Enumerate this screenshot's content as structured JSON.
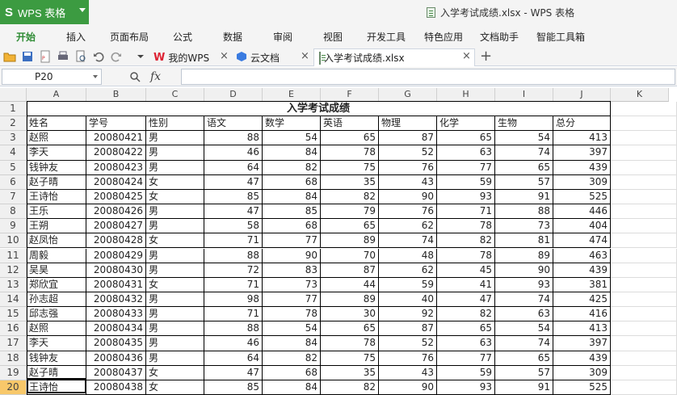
{
  "app": {
    "button_label": "WPS 表格",
    "window_title": "入学考试成绩.xlsx - WPS 表格"
  },
  "menu": [
    "开始",
    "插入",
    "页面布局",
    "公式",
    "数据",
    "审阅",
    "视图",
    "开发工具",
    "特色应用",
    "文档助手",
    "智能工具箱"
  ],
  "tabs": [
    {
      "label": "我的WPS",
      "icon": "wps-logo-icon"
    },
    {
      "label": "云文档",
      "icon": "cloud-cube-icon"
    },
    {
      "label": "入学考试成绩.xlsx",
      "icon": "spreadsheet-file-icon"
    }
  ],
  "formula_bar": {
    "name_box": "P20",
    "fx_label": "fx",
    "value": ""
  },
  "columns": [
    "A",
    "B",
    "C",
    "D",
    "E",
    "F",
    "G",
    "H",
    "I",
    "J",
    "K"
  ],
  "rows": [
    "1",
    "2",
    "3",
    "4",
    "5",
    "6",
    "7",
    "8",
    "9",
    "10",
    "11",
    "12",
    "13",
    "14",
    "15",
    "16",
    "17",
    "18",
    "19",
    "20"
  ],
  "selected_row": "20",
  "sheet": {
    "title": "入学考试成绩",
    "headers": [
      "姓名",
      "学号",
      "性别",
      "语文",
      "数学",
      "英语",
      "物理",
      "化学",
      "生物",
      "总分"
    ],
    "records": [
      [
        "赵照",
        "20080421",
        "男",
        "88",
        "54",
        "65",
        "87",
        "65",
        "54",
        "413"
      ],
      [
        "李天",
        "20080422",
        "男",
        "46",
        "84",
        "78",
        "52",
        "63",
        "74",
        "397"
      ],
      [
        "钱钟友",
        "20080423",
        "男",
        "64",
        "82",
        "75",
        "76",
        "77",
        "65",
        "439"
      ],
      [
        "赵子晴",
        "20080424",
        "女",
        "47",
        "68",
        "35",
        "43",
        "59",
        "57",
        "309"
      ],
      [
        "王诗怡",
        "20080425",
        "女",
        "85",
        "84",
        "82",
        "90",
        "93",
        "91",
        "525"
      ],
      [
        "王乐",
        "20080426",
        "男",
        "47",
        "85",
        "79",
        "76",
        "71",
        "88",
        "446"
      ],
      [
        "王朔",
        "20080427",
        "男",
        "58",
        "68",
        "65",
        "62",
        "78",
        "73",
        "404"
      ],
      [
        "赵凤怡",
        "20080428",
        "女",
        "71",
        "77",
        "89",
        "74",
        "82",
        "81",
        "474"
      ],
      [
        "周毅",
        "20080429",
        "男",
        "88",
        "90",
        "70",
        "48",
        "78",
        "89",
        "463"
      ],
      [
        "吴昊",
        "20080430",
        "男",
        "72",
        "83",
        "87",
        "62",
        "45",
        "90",
        "439"
      ],
      [
        "郑欣宜",
        "20080431",
        "女",
        "71",
        "73",
        "44",
        "59",
        "41",
        "93",
        "381"
      ],
      [
        "孙志超",
        "20080432",
        "男",
        "98",
        "77",
        "89",
        "40",
        "47",
        "74",
        "425"
      ],
      [
        "邱志强",
        "20080433",
        "男",
        "71",
        "78",
        "30",
        "92",
        "82",
        "63",
        "416"
      ],
      [
        "赵照",
        "20080434",
        "男",
        "88",
        "54",
        "65",
        "87",
        "65",
        "54",
        "413"
      ],
      [
        "李天",
        "20080435",
        "男",
        "46",
        "84",
        "78",
        "52",
        "63",
        "74",
        "397"
      ],
      [
        "钱钟友",
        "20080436",
        "男",
        "64",
        "82",
        "75",
        "76",
        "77",
        "65",
        "439"
      ],
      [
        "赵子晴",
        "20080437",
        "女",
        "47",
        "68",
        "35",
        "43",
        "59",
        "57",
        "309"
      ],
      [
        "王诗怡",
        "20080438",
        "女",
        "85",
        "84",
        "82",
        "90",
        "93",
        "91",
        "525"
      ]
    ]
  }
}
